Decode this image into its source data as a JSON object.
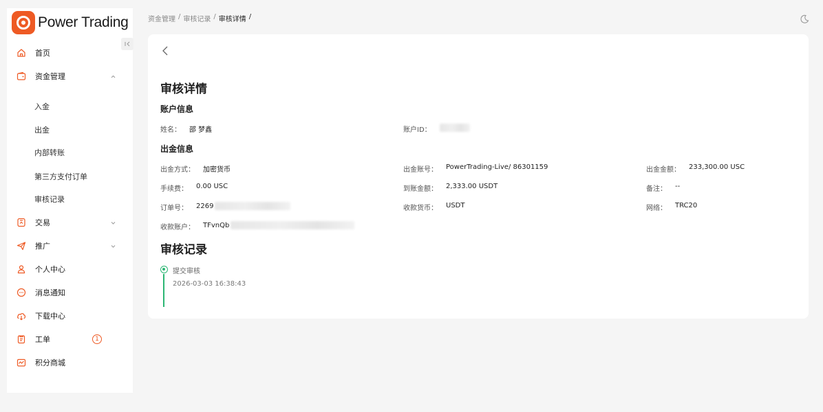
{
  "brand": {
    "name": "Power Trading",
    "accent": "#ee5a24"
  },
  "sidebar": {
    "items": [
      {
        "label": "首页",
        "icon": "home-icon"
      },
      {
        "label": "资金管理",
        "icon": "wallet-icon",
        "expanded": true,
        "children": [
          "入金",
          "出金",
          "内部转账",
          "第三方支付订单",
          "审核记录"
        ]
      },
      {
        "label": "交易",
        "icon": "trade-icon"
      },
      {
        "label": "推广",
        "icon": "send-icon"
      },
      {
        "label": "个人中心",
        "icon": "user-icon"
      },
      {
        "label": "消息通知",
        "icon": "message-icon"
      },
      {
        "label": "下载中心",
        "icon": "cloud-download-icon"
      },
      {
        "label": "工单",
        "icon": "ticket-icon",
        "badge": "1"
      },
      {
        "label": "积分商城",
        "icon": "shop-icon"
      }
    ]
  },
  "breadcrumb": [
    "资金管理",
    "审核记录",
    "审核详情"
  ],
  "breadcrumb_sep": "/",
  "page": {
    "title": "审核详情",
    "account_section": "账户信息",
    "withdraw_section": "出金信息",
    "review_section": "审核记录"
  },
  "account": {
    "name_label": "姓名：",
    "name_value": "邵 梦鑫",
    "id_label": "账户ID："
  },
  "withdraw": {
    "method_label": "出金方式：",
    "method_value": "加密货币",
    "account_label": "出金账号：",
    "account_value": "PowerTrading-Live/ 86301159",
    "amount_label": "出金金额：",
    "amount_value": "233,300.00 USC",
    "fee_label": "手续费：",
    "fee_value": "0.00 USC",
    "received_label": "到账金额：",
    "received_value": "2,333.00 USDT",
    "remark_label": "备注：",
    "remark_value": "--",
    "order_label": "订单号：",
    "order_value": "2269",
    "currency_label": "收款货币：",
    "currency_value": "USDT",
    "network_label": "网络：",
    "network_value": "TRC20",
    "wallet_label": "收款账户：",
    "wallet_value": "TFvnQb"
  },
  "review": {
    "steps": [
      {
        "label": "提交审核",
        "time": "2026-03-03 16:38:43",
        "status_color": "#2bb673"
      }
    ]
  }
}
